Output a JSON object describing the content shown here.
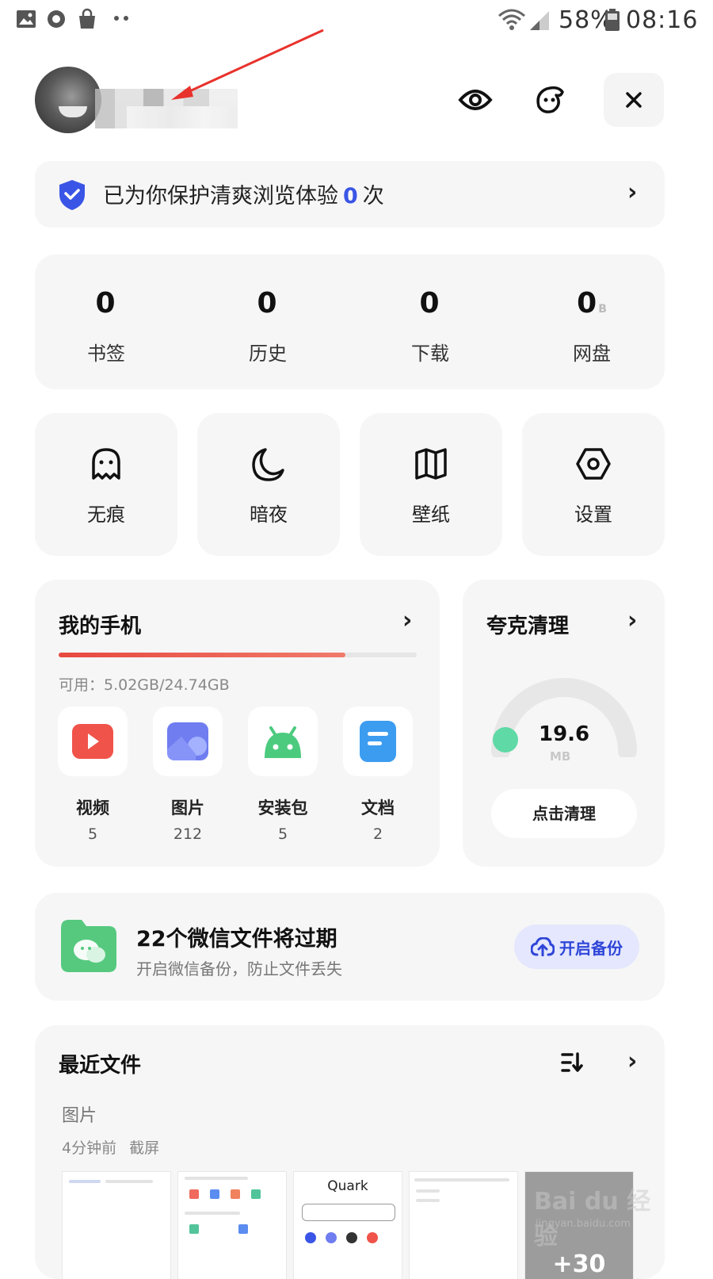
{
  "status_bar": {
    "battery": "58%",
    "time": "08:16"
  },
  "header": {
    "username": ""
  },
  "protect": {
    "text_before": "已为你保护清爽浏览体验",
    "count": "0",
    "text_after": "次"
  },
  "stats": [
    {
      "value": "0",
      "label": "书签",
      "unit": ""
    },
    {
      "value": "0",
      "label": "历史",
      "unit": ""
    },
    {
      "value": "0",
      "label": "下载",
      "unit": ""
    },
    {
      "value": "0",
      "label": "网盘",
      "unit": "B"
    }
  ],
  "tools": [
    {
      "label": "无痕",
      "icon": "ghost-icon"
    },
    {
      "label": "暗夜",
      "icon": "moon-icon"
    },
    {
      "label": "壁纸",
      "icon": "book-open-icon"
    },
    {
      "label": "设置",
      "icon": "hexagon-gear-icon"
    }
  ],
  "my_phone": {
    "title": "我的手机",
    "storage_text": "可用：5.02GB/24.74GB",
    "used_fraction": 0.8,
    "types": [
      {
        "name": "视频",
        "count": "5",
        "icon": "video-icon"
      },
      {
        "name": "图片",
        "count": "212",
        "icon": "image-icon"
      },
      {
        "name": "安装包",
        "count": "5",
        "icon": "android-icon"
      },
      {
        "name": "文档",
        "count": "2",
        "icon": "document-icon"
      }
    ]
  },
  "cleaner": {
    "title": "夸克清理",
    "value": "19.6",
    "unit": "MB",
    "button": "点击清理"
  },
  "wechat": {
    "title": "22个微信文件将过期",
    "subtitle": "开启微信备份，防止文件丢失",
    "button": "开启备份"
  },
  "recent": {
    "title": "最近文件",
    "category": "图片",
    "meta": "4分钟前 截屏",
    "thumbs": [
      {
        "caption": ""
      },
      {
        "caption": ""
      },
      {
        "caption": "Quark"
      },
      {
        "caption": ""
      },
      {
        "caption": "+30"
      }
    ]
  },
  "watermark": {
    "text": "Bai du 经验",
    "sub": "jingyan.baidu.com"
  },
  "colors": {
    "accent_blue": "#3a55e6",
    "storage_red": "#e8483f",
    "clean_green": "#5fd9a6"
  }
}
